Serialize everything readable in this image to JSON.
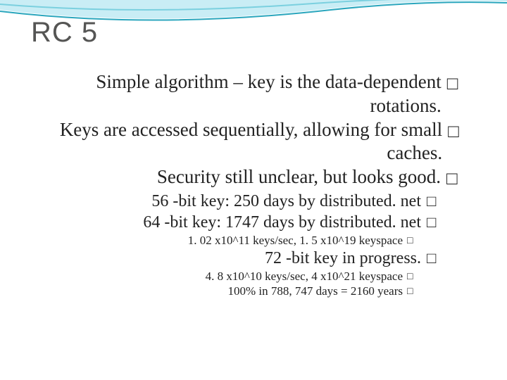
{
  "title": "RC 5",
  "bullet": "□",
  "lines": {
    "a": "Simple algorithm – key is the data-dependent rotations.",
    "b": "Keys are accessed sequentially, allowing for small caches.",
    "c": "Security still unclear, but looks good.",
    "d": "56 -bit key: 250 days by distributed. net",
    "e": "64 -bit key: 1747 days by distributed. net",
    "f": "1. 02 x10^11 keys/sec, 1. 5 x10^19 keyspace",
    "g": "72 -bit key in progress.",
    "h": "4. 8 x10^10 keys/sec, 4 x10^21 keyspace",
    "i": "100% in 788, 747 days = 2160 years"
  }
}
